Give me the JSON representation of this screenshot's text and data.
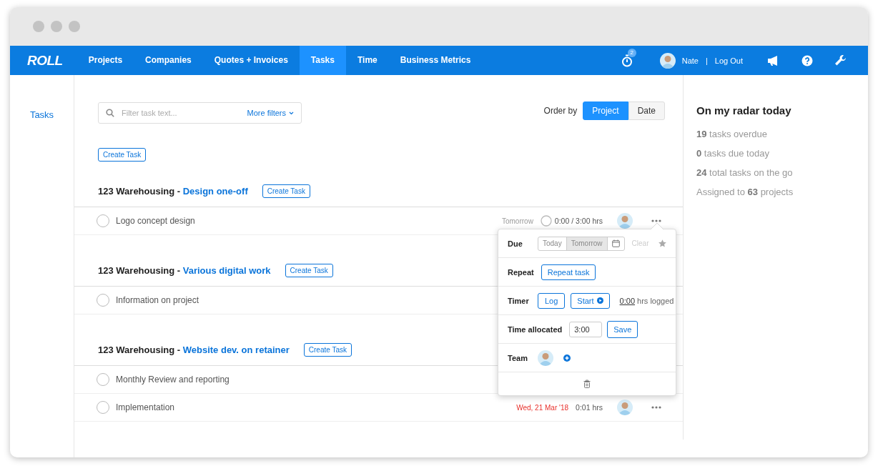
{
  "nav": {
    "logo": "ROLL",
    "items": [
      {
        "label": "Projects",
        "selected": false
      },
      {
        "label": "Companies",
        "selected": false
      },
      {
        "label": "Quotes + Invoices",
        "selected": false
      },
      {
        "label": "Tasks",
        "selected": true
      },
      {
        "label": "Time",
        "selected": false
      },
      {
        "label": "Business Metrics",
        "selected": false
      }
    ],
    "timer_count": "2",
    "user": "Nate",
    "separator": "|",
    "logout": "Log Out"
  },
  "sidebar": {
    "items": [
      {
        "label": "Tasks",
        "selected": true
      }
    ]
  },
  "filter": {
    "placeholder": "Filter task text...",
    "more_filters": "More filters"
  },
  "order_by": {
    "label": "Order by",
    "options": [
      {
        "label": "Project",
        "selected": true
      },
      {
        "label": "Date",
        "selected": false
      }
    ]
  },
  "create_task": "Create Task",
  "groups": [
    {
      "client": "123 Warehousing",
      "separator": "-",
      "project": "Design one-off",
      "create_task": "Create Task",
      "tasks": [
        {
          "name": "Logo concept design",
          "checked": false,
          "due": "Tomorrow",
          "overdue": false,
          "timer_icon": true,
          "time": "0:00 / 3:00 hrs"
        }
      ]
    },
    {
      "client": "123 Warehousing",
      "separator": "-",
      "project": "Various digital work",
      "create_task": "Create Task",
      "tasks": [
        {
          "name": "Information on project",
          "checked": false
        }
      ]
    },
    {
      "client": "123 Warehousing",
      "separator": "-",
      "project": "Website dev. on retainer",
      "create_task": "Create Task",
      "tasks": [
        {
          "name": "Monthly Review and reporting",
          "checked": false
        },
        {
          "name": "Implementation",
          "checked": false,
          "due": "Wed, 21 Mar '18",
          "overdue": true,
          "timer_icon": false,
          "time": "0:01 hrs"
        }
      ]
    }
  ],
  "popup": {
    "due": {
      "label": "Due",
      "options": [
        {
          "label": "Today",
          "selected": false
        },
        {
          "label": "Tomorrow",
          "selected": true
        }
      ],
      "clear": {
        "label": "Clear",
        "disabled": true
      }
    },
    "repeat": {
      "label": "Repeat",
      "button": "Repeat task"
    },
    "timer": {
      "label": "Timer",
      "log": "Log",
      "start": "Start",
      "logged": "0:00",
      "logged_suffix": "hrs logged"
    },
    "time_allocated": {
      "label": "Time allocated",
      "value": "3:00",
      "save": "Save"
    },
    "team": {
      "label": "Team"
    }
  },
  "radar": {
    "title": "On my radar today",
    "stats": [
      "**19** tasks overdue",
      "**0** tasks due today",
      "**24** total tasks on the go",
      "Assigned to **63** projects"
    ]
  }
}
